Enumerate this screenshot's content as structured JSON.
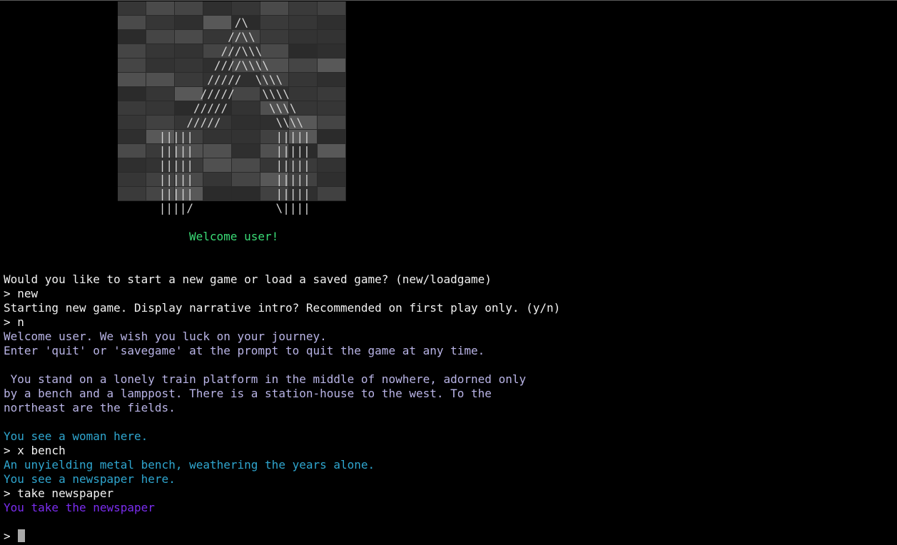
{
  "art": {
    "lines": [
      "                 /\\",
      "                //\\\\",
      "               ///\\\\\\",
      "              ////\\\\\\\\",
      "             /////  \\\\\\\\",
      "            /////    \\\\\\\\",
      "           /////      \\\\\\\\",
      "          /////        \\\\\\\\",
      "      |||||            |||||",
      "      |||||            |||||",
      "      |||||            |||||",
      "      |||||            |||||",
      "      |||||            |||||",
      "      ||||/            \\||||",
      "======||||/             \\|||======"
    ]
  },
  "welcome": "Welcome user!",
  "console": [
    {
      "cls": "sys",
      "text": "Would you like to start a new game or load a saved game? (new/loadgame)"
    },
    {
      "cls": "prompt",
      "text": "> new"
    },
    {
      "cls": "sys",
      "text": "Starting new game. Display narrative intro? Recommended on first play only. (y/n)"
    },
    {
      "cls": "prompt",
      "text": "> n"
    },
    {
      "cls": "narr",
      "text": "Welcome user. We wish you luck on your journey."
    },
    {
      "cls": "narr",
      "text": "Enter 'quit' or 'savegame' at the prompt to quit the game at any time."
    },
    {
      "cls": "narr",
      "text": ""
    },
    {
      "cls": "narr",
      "text": " You stand on a lonely train platform in the middle of nowhere, adorned only"
    },
    {
      "cls": "narr",
      "text": "by a bench and a lamppost. There is a station-house to the west. To the"
    },
    {
      "cls": "narr",
      "text": "northeast are the fields."
    },
    {
      "cls": "narr",
      "text": ""
    },
    {
      "cls": "look",
      "text": "You see a woman here."
    },
    {
      "cls": "prompt",
      "text": "> x bench"
    },
    {
      "cls": "look",
      "text": "An unyielding metal bench, weathering the years alone."
    },
    {
      "cls": "look",
      "text": "You see a newspaper here."
    },
    {
      "cls": "prompt",
      "text": "> take newspaper"
    },
    {
      "cls": "act",
      "text": "You take the newspaper"
    }
  ],
  "input": {
    "prompt": ">",
    "value": ""
  },
  "colors": {
    "background": "#000000",
    "welcome": "#3adb76",
    "narrative": "#b9b4e6",
    "observation": "#2fa6cf",
    "action": "#7b2df0"
  }
}
